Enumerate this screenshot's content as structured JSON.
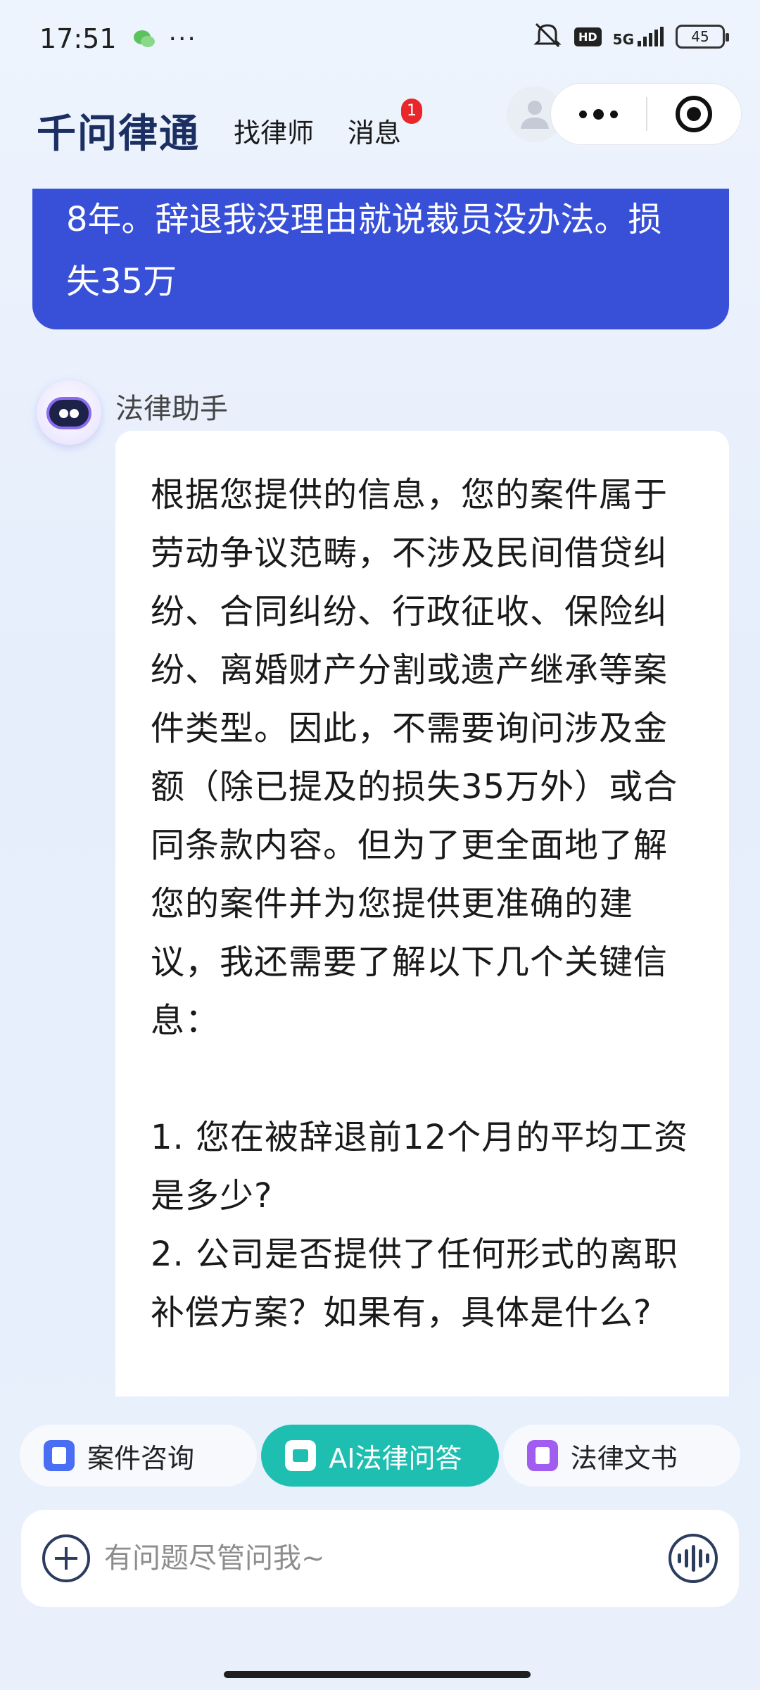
{
  "status_bar": {
    "time": "17:51",
    "dots": "···",
    "hd": "HD",
    "network": "5G",
    "battery": "45"
  },
  "header": {
    "logo": "千问律通",
    "nav": [
      {
        "label": "找律师"
      },
      {
        "label": "消息",
        "badge": "1"
      }
    ]
  },
  "chat": {
    "user_message": "8年。辞退我没理由就说裁员没办法。损失35万",
    "assistant_name": "法律助手",
    "assistant_message": "根据您提供的信息，您的案件属于劳动争议范畴，不涉及民间借贷纠纷、合同纠纷、行政征收、保险纠纷、离婚财产分割或遗产继承等案件类型。因此，不需要询问涉及金额（除已提及的损失35万外）或合同条款内容。但为了更全面地了解您的案件并为您提供更准确的建议，我还需要了解以下几个关键信息：\n\n1. 您在被辞退前12个月的平均工资是多少?\n2. 公司是否提供了任何形式的离职补偿方案？如果有，具体是什么?"
  },
  "tabs": [
    {
      "label": "案件咨询",
      "icon": "case-icon",
      "active": false
    },
    {
      "label": "AI法律问答",
      "icon": "ai-chat-icon",
      "active": true
    },
    {
      "label": "法律文书",
      "icon": "document-edit-icon",
      "active": false
    }
  ],
  "input": {
    "placeholder": "有问题尽管问我~"
  },
  "colors": {
    "user_bubble": "#3850d8",
    "active_tab": "#1ebfb1",
    "badge": "#e8262b",
    "logo": "#1b2f63"
  }
}
